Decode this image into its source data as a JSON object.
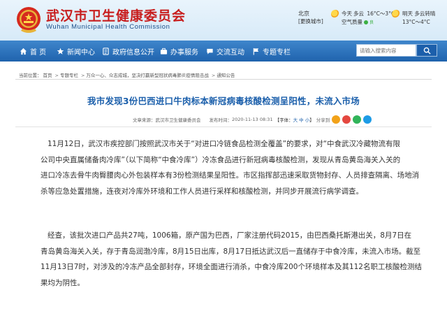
{
  "site": {
    "title": "武汉市卫生健康委员会",
    "subtitle": "Wuhan Municipal Health Commission",
    "colors": {
      "title": "#c81e1e",
      "nav": "#2a6fba",
      "article_title": "#1b5fab"
    }
  },
  "weather": {
    "city": "北京",
    "switch_city": "[更换城市]",
    "today_label": "今天",
    "today_condition": "多云",
    "today_temp": "16°C～3°C",
    "aqi_label": "空气质量",
    "aqi_value": "良",
    "tomorrow_label": "明天",
    "tomorrow_condition": "多云转晴",
    "tomorrow_temp": "13°C～4°C"
  },
  "nav": {
    "items": [
      {
        "label": "首 页",
        "icon": "home-icon"
      },
      {
        "label": "新闻中心",
        "icon": "star-icon"
      },
      {
        "label": "政府信息公开",
        "icon": "doc-icon"
      },
      {
        "label": "办事服务",
        "icon": "briefcase-icon"
      },
      {
        "label": "交流互动",
        "icon": "chat-icon"
      },
      {
        "label": "专题专栏",
        "icon": "flag-icon"
      }
    ],
    "search_placeholder": "请输入搜索内容"
  },
  "breadcrumb": {
    "prefix": "当前位置：",
    "items": [
      "首页",
      "专题专栏",
      "万众一心、众志成城，坚决打赢新型冠状病毒肺炎疫情阻击战",
      "通知公告"
    ]
  },
  "article": {
    "title": "我市发现3份巴西进口牛肉标本新冠病毒核酸检测呈阳性，未流入市场",
    "source_label": "文章来源：",
    "source": "武汉市卫生健康委员会",
    "time_label": "发布时间：",
    "time": "2020-11-13 08:31",
    "font_label": "【字体：",
    "font_large": "大",
    "font_medium": "中",
    "font_small": "小",
    "font_close": "】",
    "share_label": "分享到",
    "p1_lines": [
      "11月12日，武汉市疾控部门按照武汉市关于“对进口冷链食品检测全覆盖”的要求，对“中食武汉冷藏物流有限",
      "公司中央直属储备肉冷库”（以下简称“中食冷库”）冷冻食品进行新冠病毒核酸检测，发现从青岛黄岛海关入关的",
      "进口冷冻去骨牛肉臀腰肉心外包装样本有3份检测结果呈阳性。市区指挥部迅速采取货物封存、人员排查隔离、场地消",
      "杀等应急处置措施，连夜对冷库外环境和工作人员进行采样和核酸检测，并同步开展流行病学调查。"
    ],
    "p2_lines": [
      "经查，该批次进口产品共27吨，1006箱，原产国为巴西，厂家注册代码2015，由巴西桑托斯港出关，8月7日在",
      "青岛黄岛海关入关，存于青岛润渤冷库，8月15日出库，8月17日抵达武汉后一直储存于中食冷库，未流入市场。截至",
      "11月13日7时，对涉及的冷冻产品全部封存，环境全面进行消杀，中食冷库200个环境样本及其112名职工核酸检测结",
      "果均为阴性。"
    ]
  }
}
